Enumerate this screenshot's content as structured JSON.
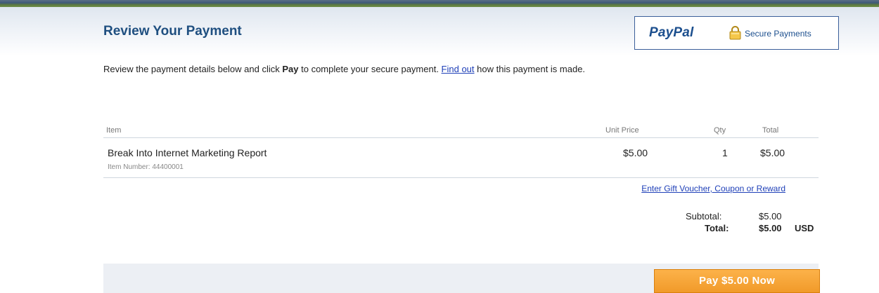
{
  "header": {
    "title": "Review Your Payment",
    "badge": {
      "logo_text": "PayPal",
      "secure_text": "Secure Payments"
    }
  },
  "intro": {
    "text_before": "Review the payment details below and click ",
    "bold_word": "Pay",
    "text_middle": " to complete your secure payment. ",
    "link_text": "Find out",
    "text_after": " how this payment is made."
  },
  "table": {
    "columns": {
      "item": "Item",
      "unit_price": "Unit Price",
      "qty": "Qty",
      "total": "Total"
    },
    "rows": [
      {
        "name": "Break Into Internet Marketing Report",
        "item_number": "Item Number: 44400001",
        "unit_price": "$5.00",
        "qty": "1",
        "total": "$5.00"
      }
    ]
  },
  "gift_link": "Enter Gift Voucher, Coupon or Reward",
  "summary": {
    "subtotal_label": "Subtotal:",
    "subtotal_value": "$5.00",
    "total_label": "Total:",
    "total_value": "$5.00",
    "currency": "USD"
  },
  "pay_button": "Pay $5.00 Now"
}
